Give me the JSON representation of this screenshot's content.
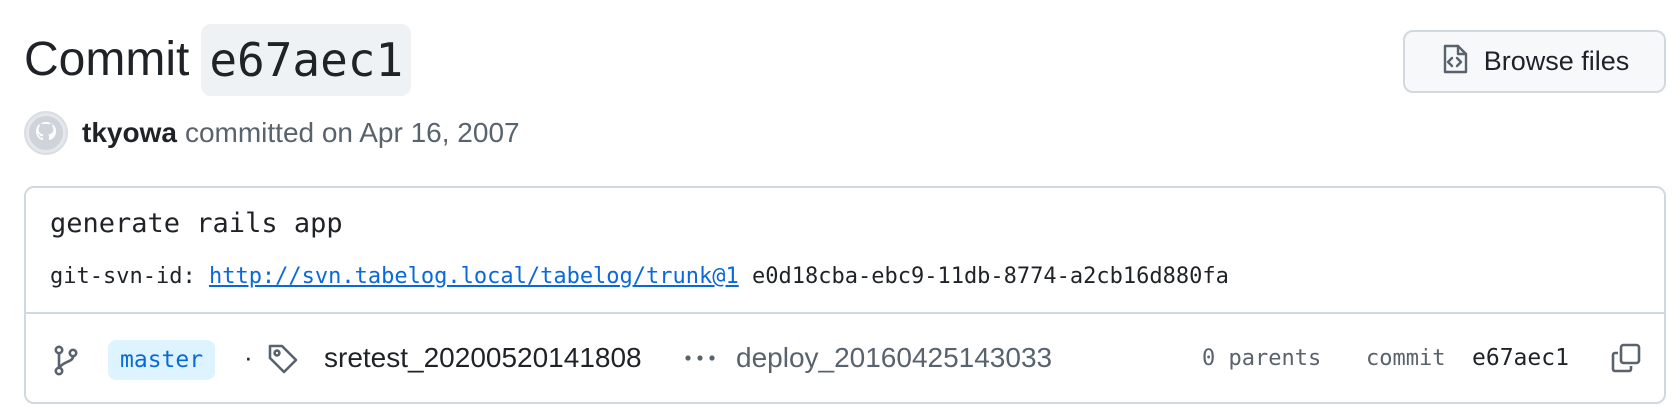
{
  "header": {
    "title_word": "Commit",
    "title_sha": "e67aec1",
    "browse_files_label": "Browse files",
    "browse_files_icon": "file-code-icon"
  },
  "author": {
    "avatar_icon": "github-avatar-icon",
    "name": "tkyowa",
    "committed_text": "committed on Apr 16, 2007"
  },
  "message": {
    "title": "generate rails app",
    "svn_prefix": "git-svn-id:",
    "svn_link": "http://svn.tabelog.local/tabelog/trunk@1",
    "svn_uuid": "e0d18cba-ebc9-11db-8774-a2cb16d880fa"
  },
  "footer": {
    "branch_icon": "git-branch-icon",
    "branch": "master",
    "separator": "·",
    "tag_icon": "tag-icon",
    "tag_first": "sretest_20200520141808",
    "more_icon": "kebab-horizontal-icon",
    "tag_last": "deploy_20160425143033",
    "parents": "0 parents",
    "commit_label": "commit",
    "commit_sha": "e67aec1",
    "copy_icon": "copy-icon"
  },
  "colors": {
    "link": "#0969da",
    "branch_badge_bg": "#ddf4ff",
    "border": "#d1d9e0",
    "muted_text": "#59636e"
  }
}
